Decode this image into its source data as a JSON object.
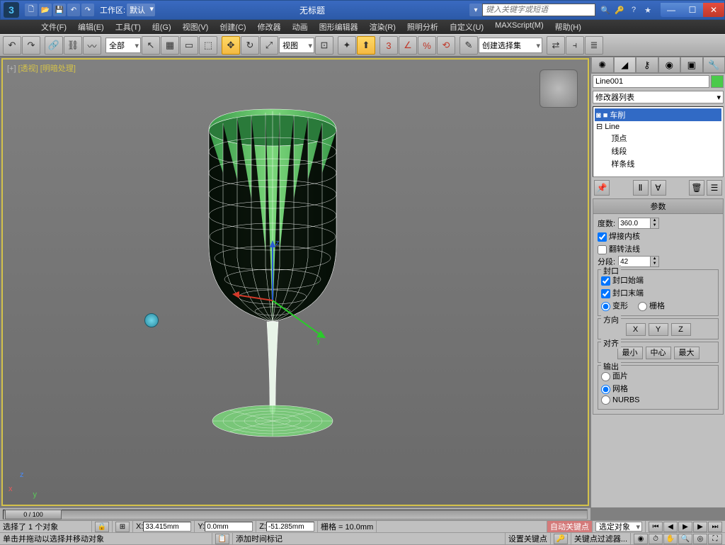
{
  "titlebar": {
    "workspace_label": "工作区:",
    "workspace_value": "默认",
    "title": "无标题",
    "search_placeholder": "键入关键字或短语"
  },
  "menu": {
    "file": "文件(F)",
    "edit": "编辑(E)",
    "tools": "工具(T)",
    "group": "组(G)",
    "views": "视图(V)",
    "create": "创建(C)",
    "modifiers": "修改器",
    "animation": "动画",
    "graph": "图形编辑器",
    "render": "渲染(R)",
    "lighting": "照明分析",
    "customize": "自定义(U)",
    "maxscript": "MAXScript(M)",
    "help": "帮助(H)"
  },
  "toolbar": {
    "filter_all": "全部",
    "ref_view": "视图",
    "sel_set": "创建选择集"
  },
  "viewport": {
    "label_plus": "[+]",
    "label_view": "[透视]",
    "label_shade": "[明暗处理]"
  },
  "cmdpanel": {
    "object_name": "Line001",
    "modifier_list": "修改器列表",
    "stack": {
      "lathe": "◙ ■ 车削",
      "line": "⊟ Line",
      "vertex": "       顶点",
      "segment": "       线段",
      "spline": "       样条线"
    },
    "rollout_params": "参数",
    "degrees_label": "度数:",
    "degrees_value": "360.0",
    "weld_core": "焊接内核",
    "flip_normals": "翻转法线",
    "segments_label": "分段:",
    "segments_value": "42",
    "capping_title": "封口",
    "cap_start": "封口始端",
    "cap_end": "封口末端",
    "morph": "变形",
    "grid": "栅格",
    "direction_title": "方向",
    "axis_x": "X",
    "axis_y": "Y",
    "axis_z": "Z",
    "align_title": "对齐",
    "align_min": "最小",
    "align_center": "中心",
    "align_max": "最大",
    "output_title": "输出",
    "out_patch": "面片",
    "out_mesh": "网格",
    "out_nurbs": "NURBS"
  },
  "timeline": {
    "handle": "0 / 100"
  },
  "status": {
    "selected": "选择了 1 个对象",
    "x": "33.415mm",
    "y": "0.0mm",
    "z": "-51.285mm",
    "grid": "栅格 = 10.0mm",
    "autokey": "自动关键点",
    "selected_obj": "选定对象",
    "setkey": "设置关键点",
    "keyfilter": "关键点过滤器...",
    "prompt": "单击并拖动以选择并移动对象",
    "addtime": "添加时间标记"
  }
}
